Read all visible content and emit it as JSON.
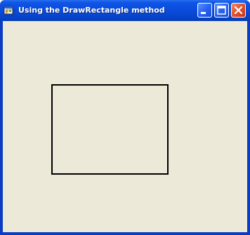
{
  "window": {
    "title": "Using the DrawRectangle method",
    "icon": "app-window-icon"
  },
  "caption_buttons": [
    {
      "name": "minimize",
      "icon": "minimize-icon"
    },
    {
      "name": "maximize",
      "icon": "maximize-icon"
    },
    {
      "name": "close",
      "icon": "close-icon"
    }
  ],
  "colors": {
    "titlebar": "#0a4bd9",
    "client_background": "#ece9d8",
    "rectangle_stroke": "#000000",
    "close_button": "#e0502c"
  },
  "canvas": {
    "shape": "rectangle",
    "fill": "none"
  }
}
